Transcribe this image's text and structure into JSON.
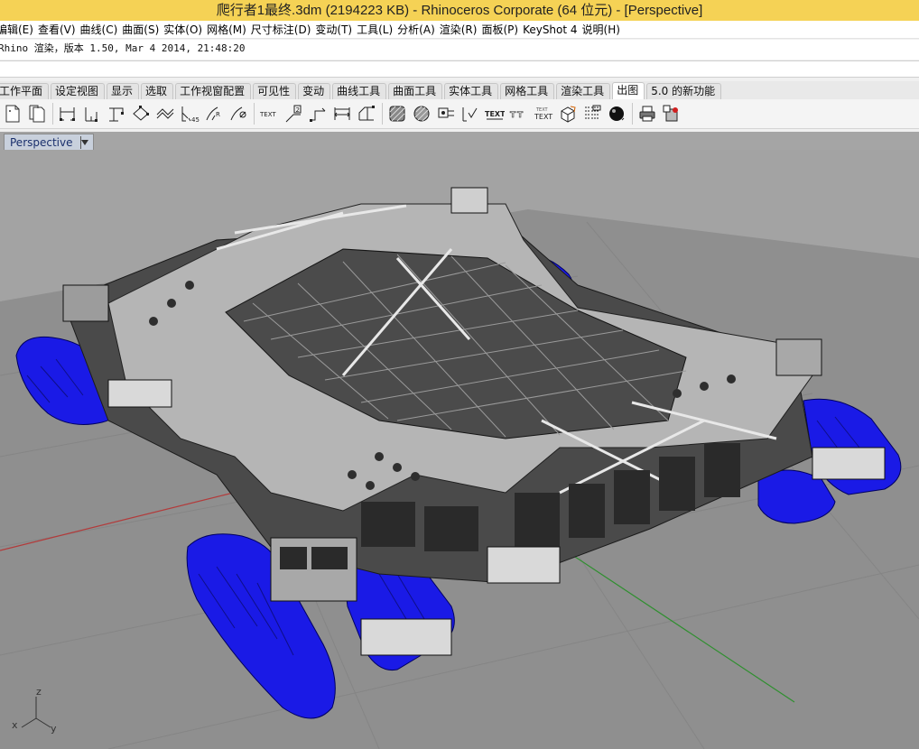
{
  "window": {
    "title": "爬行者1最终.3dm (2194223 KB) - Rhinoceros Corporate (64 位元) - [Perspective]"
  },
  "menubar": {
    "items": [
      "编辑(E)",
      "查看(V)",
      "曲线(C)",
      "曲面(S)",
      "实体(O)",
      "网格(M)",
      "尺寸标注(D)",
      "变动(T)",
      "工具(L)",
      "分析(A)",
      "渲染(R)",
      "面板(P)",
      "KeyShot 4",
      "说明(H)"
    ]
  },
  "command": {
    "history_text": "Rhino 渲染，版本 1.50, Mar  4 2014, 21:48:20",
    "prompt_text": ""
  },
  "toolbar_tabs": {
    "items": [
      "工作平面",
      "设定视图",
      "显示",
      "选取",
      "工作视窗配置",
      "可见性",
      "变动",
      "曲线工具",
      "曲面工具",
      "实体工具",
      "网格工具",
      "渲染工具",
      "出图",
      "5.0 的新功能"
    ],
    "active_index": 12
  },
  "toolbar": {
    "icons": [
      "new-layout-icon",
      "copy-layout-icon",
      "linear-dimension-icon",
      "aligned-dimension-icon",
      "rotated-dimension-icon",
      "angle-dimension-icon",
      "radius-dimension-icon",
      "ordinate-dimension-icon",
      "arc-length-dimension-icon",
      "diameter-dimension-icon",
      "text-icon",
      "leader-icon",
      "dimension-edit-icon",
      "arrow-dimension-icon",
      "dimension-style-icon",
      "hatch-icon",
      "hatch-boundary-icon",
      "clipping-icon",
      "checkmark-icon",
      "text-object-icon",
      "text-engrave-icon",
      "text-block-icon",
      "make-2d-icon",
      "detail-view-icon",
      "sphere-material-icon",
      "print-icon",
      "layout-properties-icon"
    ],
    "text_icon_labels": {
      "text": "TEXT",
      "text2": "TEXT",
      "text_block_top": "TEXT",
      "text_block_bottom": "TEXT"
    }
  },
  "viewport": {
    "tab_label": "Perspective",
    "axis_labels": {
      "z": "z",
      "x": "x",
      "y": "y"
    },
    "colors": {
      "background": "#a3a3a3",
      "floor": "#8f8f8f",
      "x_axis": "#b33a3a",
      "y_axis": "#2f8f2f",
      "tracks": "#1a1ae6",
      "structure_dark": "#3a3a3a",
      "structure_light": "#d8d8d8"
    }
  }
}
